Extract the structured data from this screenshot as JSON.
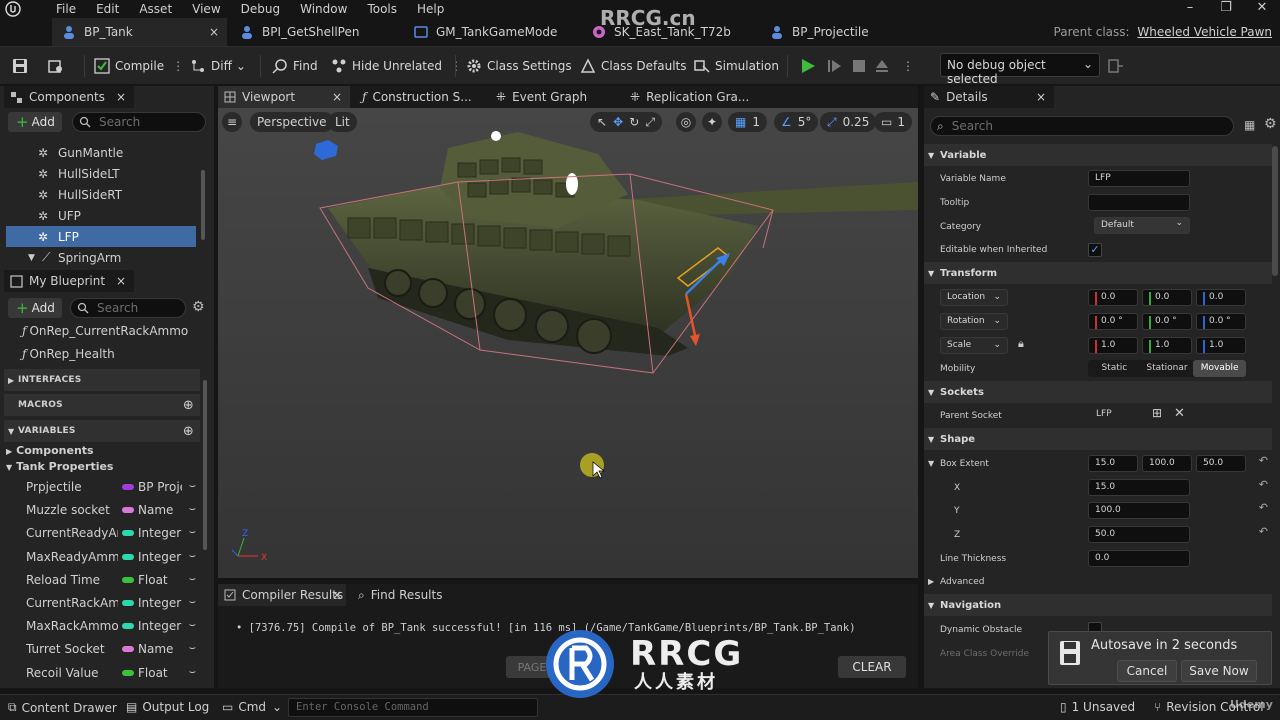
{
  "menu": [
    "File",
    "Edit",
    "Asset",
    "View",
    "Debug",
    "Window",
    "Tools",
    "Help"
  ],
  "tabs": [
    {
      "label": "BP_Tank",
      "close": "×"
    },
    {
      "label": "BPI_GetShellPen"
    },
    {
      "label": "GM_TankGameMode"
    },
    {
      "label": "SK_East_Tank_T72b"
    },
    {
      "label": "BP_Projectile"
    }
  ],
  "parent_class": {
    "label": "Parent class:",
    "value": "Wheeled Vehicle Pawn"
  },
  "toolbar": {
    "compile": "Compile",
    "diff": "Diff",
    "find": "Find",
    "hide_unrelated": "Hide Unrelated",
    "class_settings": "Class Settings",
    "class_defaults": "Class Defaults",
    "simulation": "Simulation",
    "debug_object": "No debug object selected"
  },
  "components": {
    "tab_label": "Components",
    "add_label": "Add",
    "search_placeholder": "Search",
    "items": [
      "GunMantle",
      "HullSideLT",
      "HullSideRT",
      "UFP",
      "LFP",
      "SpringArm"
    ],
    "selected": "LFP"
  },
  "my_blueprint": {
    "tab_label": "My Blueprint",
    "add_label": "Add",
    "search_placeholder": "Search",
    "functions": [
      "OnRep_CurrentRackAmmo",
      "OnRep_Health"
    ],
    "sections": {
      "interfaces": "INTERFACES",
      "macros": "MACROS",
      "variables": "VARIABLES"
    },
    "groups": {
      "components": "Components",
      "tank_properties": "Tank Properties"
    },
    "variables": [
      {
        "name": "Prpjectile",
        "type": "BP Proje",
        "color": "#a03cdc"
      },
      {
        "name": "Muzzle socket",
        "type": "Name",
        "color": "#d879d8"
      },
      {
        "name": "CurrentReadyAm",
        "type": "Integer",
        "color": "#2ed7b1"
      },
      {
        "name": "MaxReadyAmmo",
        "type": "Integer",
        "color": "#2ed7b1"
      },
      {
        "name": "Reload Time",
        "type": "Float",
        "color": "#3bc23b"
      },
      {
        "name": "CurrentRackAmm",
        "type": "Integer",
        "color": "#2ed7b1"
      },
      {
        "name": "MaxRackAmmo",
        "type": "Integer",
        "color": "#2ed7b1"
      },
      {
        "name": "Turret Socket",
        "type": "Name",
        "color": "#d879d8"
      },
      {
        "name": "Recoil Value",
        "type": "Float",
        "color": "#3bc23b"
      }
    ]
  },
  "editor_tabs": [
    "Viewport",
    "Construction S...",
    "Event Graph",
    "Replication Gra..."
  ],
  "viewport": {
    "perspective": "Perspective",
    "lit": "Lit",
    "grid_snap": "1",
    "rotation_snap": "5°",
    "scale_snap": "0.25",
    "camera_speed": "1"
  },
  "results": {
    "compiler_tab": "Compiler Results",
    "find_tab": "Find Results",
    "message": "[7376.75] Compile of BP_Tank successful! [in 116 ms] (/Game/TankGame/Blueprints/BP_Tank.BP_Tank)",
    "page_label": "PAGE",
    "clear_label": "CLEAR"
  },
  "details": {
    "tab_label": "Details",
    "search_placeholder": "Search",
    "sections": {
      "variable": "Variable",
      "transform": "Transform",
      "sockets": "Sockets",
      "shape": "Shape",
      "navigation": "Navigation"
    },
    "variable_name_label": "Variable Name",
    "variable_name": "LFP",
    "tooltip_label": "Tooltip",
    "category_label": "Category",
    "category": "Default",
    "editable_label": "Editable when Inherited",
    "location_label": "Location",
    "location": [
      "0.0",
      "0.0",
      "0.0"
    ],
    "rotation_label": "Rotation",
    "rotation": [
      "0.0 °",
      "0.0 °",
      "0.0 °"
    ],
    "scale_label": "Scale",
    "scale": [
      "1.0",
      "1.0",
      "1.0"
    ],
    "mobility_label": "Mobility",
    "mobility_options": [
      "Static",
      "Stationar",
      "Movable"
    ],
    "mobility_selected": "Movable",
    "parent_socket_label": "Parent Socket",
    "parent_socket": "LFP",
    "box_extent_label": "Box Extent",
    "box_extent": [
      "15.0",
      "100.0",
      "50.0"
    ],
    "x_label": "X",
    "x": "15.0",
    "y_label": "Y",
    "y": "100.0",
    "z_label": "Z",
    "z": "50.0",
    "line_thickness_label": "Line Thickness",
    "line_thickness": "0.0",
    "advanced_label": "Advanced",
    "dynamic_obstacle_label": "Dynamic Obstacle",
    "area_class_label": "Area Class Override"
  },
  "statusbar": {
    "content_drawer": "Content Drawer",
    "output_log": "Output Log",
    "cmd": "Cmd",
    "console_placeholder": "Enter Console Command",
    "unsaved": "1 Unsaved",
    "revision_control": "Revision Control"
  },
  "autosave": {
    "message": "Autosave in 2 seconds",
    "cancel": "Cancel",
    "save_now": "Save Now"
  },
  "watermark": {
    "top": "RRCG.cn",
    "brand": "RRCG",
    "sub": "人人素材",
    "udemy": "Udemy"
  },
  "colors": {
    "accent": "#3f6aa3",
    "play": "#3dbb3d",
    "panel": "#242424"
  }
}
